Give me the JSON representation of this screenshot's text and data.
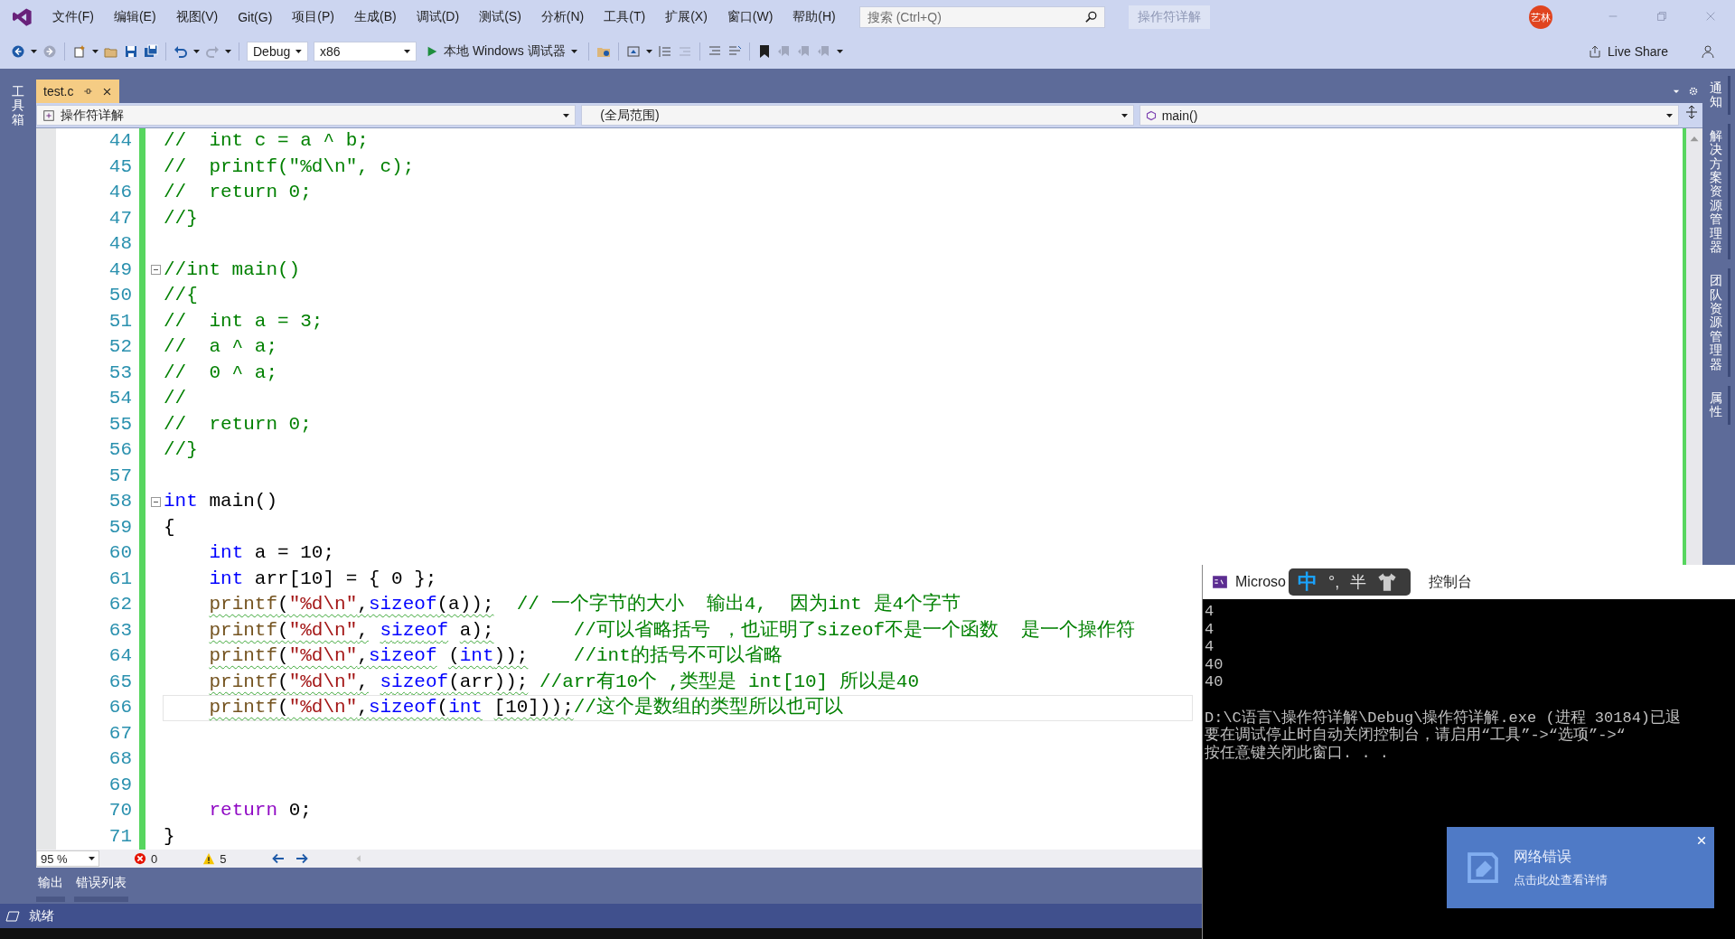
{
  "menu": [
    "文件(F)",
    "编辑(E)",
    "视图(V)",
    "Git(G)",
    "项目(P)",
    "生成(B)",
    "调试(D)",
    "测试(S)",
    "分析(N)",
    "工具(T)",
    "扩展(X)",
    "窗口(W)",
    "帮助(H)"
  ],
  "search": {
    "placeholder": "搜索 (Ctrl+Q)"
  },
  "solution_name": "操作符详解",
  "account": {
    "initials": "艺林"
  },
  "toolbar": {
    "configuration": "Debug",
    "platform": "x86",
    "debugger": "本地 Windows 调试器",
    "live_share": "Live Share"
  },
  "left_toolwindows": [
    {
      "label": "工具箱"
    }
  ],
  "right_toolwindows": [
    {
      "label": "通知"
    },
    {
      "label": "解决方案资源管理器"
    },
    {
      "label": "团队资源管理器"
    },
    {
      "label": "属性"
    }
  ],
  "tabs": [
    {
      "label": "test.c",
      "selected": true
    }
  ],
  "navigation": {
    "project": "操作符详解",
    "scope": "(全局范围)",
    "member": "main()"
  },
  "code_lines": [
    {
      "number": "44",
      "fold_start": false,
      "warning": false,
      "current": false,
      "tokens": [
        {
          "kind": "comment",
          "text": "//  int c = a ^ b;"
        }
      ]
    },
    {
      "number": "45",
      "fold_start": false,
      "warning": false,
      "current": false,
      "tokens": [
        {
          "kind": "comment",
          "text": "//  printf(\"%d\\n\", c);"
        }
      ]
    },
    {
      "number": "46",
      "fold_start": false,
      "warning": false,
      "current": false,
      "tokens": [
        {
          "kind": "comment",
          "text": "//  return 0;"
        }
      ]
    },
    {
      "number": "47",
      "fold_start": false,
      "warning": false,
      "current": false,
      "tokens": [
        {
          "kind": "comment",
          "text": "//}"
        }
      ]
    },
    {
      "number": "48"
    },
    {
      "number": "49",
      "fold_start": true,
      "warning": false,
      "current": false,
      "tokens": [
        {
          "kind": "comment",
          "text": "//int main()"
        }
      ]
    },
    {
      "number": "50",
      "fold_start": false,
      "warning": false,
      "current": false,
      "tokens": [
        {
          "kind": "comment",
          "text": "//{"
        }
      ]
    },
    {
      "number": "51",
      "fold_start": false,
      "warning": false,
      "current": false,
      "tokens": [
        {
          "kind": "comment",
          "text": "//  int a = 3;"
        }
      ]
    },
    {
      "number": "52",
      "fold_start": false,
      "warning": false,
      "current": false,
      "tokens": [
        {
          "kind": "comment",
          "text": "//  a ^ a;"
        }
      ]
    },
    {
      "number": "53",
      "fold_start": false,
      "warning": false,
      "current": false,
      "tokens": [
        {
          "kind": "comment",
          "text": "//  0 ^ a;"
        }
      ]
    },
    {
      "number": "54",
      "fold_start": false,
      "warning": false,
      "current": false,
      "tokens": [
        {
          "kind": "comment",
          "text": "//"
        }
      ]
    },
    {
      "number": "55",
      "fold_start": false,
      "warning": false,
      "current": false,
      "tokens": [
        {
          "kind": "comment",
          "text": "//  return 0;"
        }
      ]
    },
    {
      "number": "56",
      "fold_start": false,
      "warning": false,
      "current": false,
      "tokens": [
        {
          "kind": "comment",
          "text": "//}"
        }
      ]
    },
    {
      "number": "57"
    },
    {
      "number": "58",
      "fold_start": true,
      "warning": false,
      "current": false,
      "tokens": [
        {
          "kind": "keyword",
          "text": "int"
        },
        {
          "kind": "plain",
          "text": " main()"
        }
      ]
    },
    {
      "number": "59",
      "fold_start": false,
      "warning": false,
      "current": false,
      "tokens": [
        {
          "kind": "plain",
          "text": "{"
        }
      ]
    },
    {
      "number": "60",
      "fold_start": false,
      "warning": false,
      "current": false,
      "tokens": [
        {
          "kind": "keyword",
          "text": "    int"
        },
        {
          "kind": "plain",
          "text": " a = 10;"
        }
      ]
    },
    {
      "number": "61",
      "fold_start": false,
      "warning": false,
      "current": false,
      "tokens": [
        {
          "kind": "keyword",
          "text": "    int"
        },
        {
          "kind": "plain",
          "text": " arr[10] = { 0 };"
        }
      ]
    },
    {
      "number": "62",
      "fold_start": false,
      "warning": true,
      "current": false,
      "tokens": [
        {
          "kind": "function",
          "text": "    printf"
        },
        {
          "kind": "plain",
          "text": "("
        },
        {
          "kind": "string",
          "text": "\"%d\\n\""
        },
        {
          "kind": "plain",
          "text": ","
        },
        {
          "kind": "keyword",
          "text": "sizeof"
        },
        {
          "kind": "plain",
          "text": "(a));  "
        },
        {
          "kind": "comment",
          "text": "// 一个字节的大小  输出4,  因为int 是4个字节"
        }
      ]
    },
    {
      "number": "63",
      "fold_start": false,
      "warning": true,
      "current": false,
      "tokens": [
        {
          "kind": "function",
          "text": "    printf"
        },
        {
          "kind": "plain",
          "text": "("
        },
        {
          "kind": "string",
          "text": "\"%d\\n\""
        },
        {
          "kind": "plain",
          "text": ", "
        },
        {
          "kind": "keyword",
          "text": "sizeof"
        },
        {
          "kind": "plain",
          "text": " a);       "
        },
        {
          "kind": "comment",
          "text": "//可以省略括号 ，也证明了sizeof不是一个函数  是一个操作符"
        }
      ]
    },
    {
      "number": "64",
      "fold_start": false,
      "warning": true,
      "current": false,
      "tokens": [
        {
          "kind": "function",
          "text": "    printf"
        },
        {
          "kind": "plain",
          "text": "("
        },
        {
          "kind": "string",
          "text": "\"%d\\n\""
        },
        {
          "kind": "plain",
          "text": ","
        },
        {
          "kind": "keyword",
          "text": "sizeof"
        },
        {
          "kind": "plain",
          "text": " ("
        },
        {
          "kind": "keyword",
          "text": "int"
        },
        {
          "kind": "plain",
          "text": "));    "
        },
        {
          "kind": "comment",
          "text": "//int的括号不可以省略"
        }
      ]
    },
    {
      "number": "65",
      "fold_start": false,
      "warning": true,
      "current": false,
      "tokens": [
        {
          "kind": "function",
          "text": "    printf"
        },
        {
          "kind": "plain",
          "text": "("
        },
        {
          "kind": "string",
          "text": "\"%d\\n\""
        },
        {
          "kind": "plain",
          "text": ", "
        },
        {
          "kind": "keyword",
          "text": "sizeof"
        },
        {
          "kind": "plain",
          "text": "(arr)); "
        },
        {
          "kind": "comment",
          "text": "//arr有10个 ,类型是 int[10] 所以是40"
        }
      ]
    },
    {
      "number": "66",
      "fold_start": false,
      "warning": true,
      "current": true,
      "tokens": [
        {
          "kind": "function",
          "text": "    printf"
        },
        {
          "kind": "plain",
          "text": "("
        },
        {
          "kind": "string",
          "text": "\"%d\\n\""
        },
        {
          "kind": "plain",
          "text": ","
        },
        {
          "kind": "keyword",
          "text": "sizeof"
        },
        {
          "kind": "plain",
          "text": "("
        },
        {
          "kind": "keyword",
          "text": "int"
        },
        {
          "kind": "plain",
          "text": " [10]));"
        },
        {
          "kind": "comment",
          "text": "//这个是数组的类型所以也可以"
        }
      ]
    },
    {
      "number": "67"
    },
    {
      "number": "68"
    },
    {
      "number": "69"
    },
    {
      "number": "70",
      "fold_start": false,
      "warning": false,
      "current": false,
      "tokens": [
        {
          "kind": "control",
          "text": "    return"
        },
        {
          "kind": "plain",
          "text": " 0;"
        }
      ]
    },
    {
      "number": "71",
      "fold_start": false,
      "warning": false,
      "current": false,
      "tokens": [
        {
          "kind": "plain",
          "text": "}"
        }
      ]
    }
  ],
  "editor_status": {
    "zoom": "95 %",
    "errors": "0",
    "warnings": "5"
  },
  "bottom_tabs": [
    {
      "label": "输出",
      "selected": false
    },
    {
      "label": "错误列表",
      "selected": false
    }
  ],
  "status_bar": {
    "text": "就绪"
  },
  "console": {
    "title_start": "Microso",
    "title_end": "控制台",
    "output": [
      "4",
      "4",
      "4",
      "40",
      "40"
    ],
    "messages": [
      "D:\\C语言\\操作符详解\\Debug\\操作符详解.exe (进程 30184)已退",
      "要在调试停止时自动关闭控制台，请启用“工具”->“选项”->“",
      "按任意键关闭此窗口. . ."
    ]
  },
  "ime": {
    "mode": "中",
    "punctuation": "°,",
    "width": "半"
  },
  "notification": {
    "title": "网络错误",
    "message": "点击此处查看详情"
  }
}
